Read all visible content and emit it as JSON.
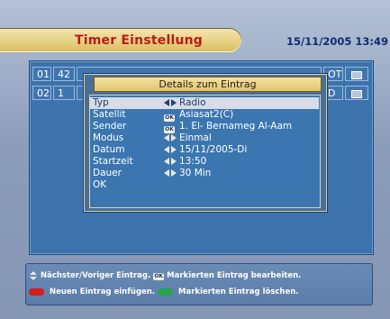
{
  "header": {
    "title": "Timer Einstellung",
    "datetime": "15/11/2005 13:49"
  },
  "timer_list": {
    "rows": [
      {
        "index": "01",
        "channel": "42",
        "name": "",
        "mode": "OT"
      },
      {
        "index": "02",
        "channel": "1",
        "name": "",
        "mode": "D"
      }
    ]
  },
  "dialog": {
    "title": "Details zum Eintrag",
    "rows": [
      {
        "label": "Typ",
        "control": "left-right-arrows",
        "value": "Radio",
        "selected": true
      },
      {
        "label": "Satellit",
        "control": "ok-badge",
        "value": "Asiasat2(C)"
      },
      {
        "label": "Sender",
        "control": "ok-badge",
        "value": "1. El- Bernameg Al-Aam"
      },
      {
        "label": "Modus",
        "control": "left-right-arrows",
        "value": "Einmal"
      },
      {
        "label": "Datum",
        "control": "left-right-arrows",
        "value": "15/11/2005-Di"
      },
      {
        "label": "Startzeit",
        "control": "left-right-arrows",
        "value": "13:50"
      },
      {
        "label": "Dauer",
        "control": "left-right-arrows",
        "value": "30 Min"
      },
      {
        "label": "OK",
        "control": "",
        "value": ""
      }
    ],
    "ok_badge_text": "OK"
  },
  "footer": {
    "line1_a": "Nächster/Voriger Eintrag.",
    "line1_badge": "OK",
    "line1_b": "Markierten Eintrag bearbeiten.",
    "line2_a": "Neuen Eintrag einfügen.",
    "line2_b": "Markierten Eintrag löschen."
  },
  "colors": {
    "title_red": "#bc1a16",
    "accent_gold": "#e6cf7e",
    "panel_blue": "#3d73ac",
    "red_key": "#d21d18",
    "green_key": "#26a54e"
  }
}
